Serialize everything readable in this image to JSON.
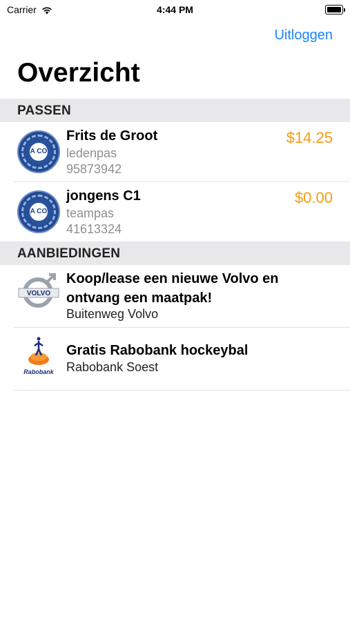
{
  "status_bar": {
    "carrier": "Carrier",
    "time": "4:44 PM"
  },
  "nav": {
    "logout": "Uitloggen"
  },
  "page": {
    "title": "Overzicht"
  },
  "sections": {
    "passes": {
      "header": "PASSEN",
      "items": [
        {
          "name": "Frits de Groot",
          "type": "ledenpas",
          "number": "95873942",
          "balance": "$14.25"
        },
        {
          "name": "jongens C1",
          "type": "teampas",
          "number": "41613324",
          "balance": "$0.00"
        }
      ]
    },
    "offers": {
      "header": "AANBIEDINGEN",
      "items": [
        {
          "title_line1": "Koop/lease een nieuwe Volvo en",
          "title_line2": "ontvang een maatpak!",
          "company": "Buitenweg Volvo"
        },
        {
          "title_line1": "Gratis Rabobank hockeybal",
          "company": "Rabobank Soest"
        }
      ]
    }
  },
  "logos": {
    "club_badge_text": "A CO",
    "volvo_text": "VOLVO",
    "rabobank_text": "Rabobank"
  },
  "colors": {
    "accent": "#1a86ff",
    "amount": "#f39c12",
    "section_bg": "#e8e8ea"
  }
}
